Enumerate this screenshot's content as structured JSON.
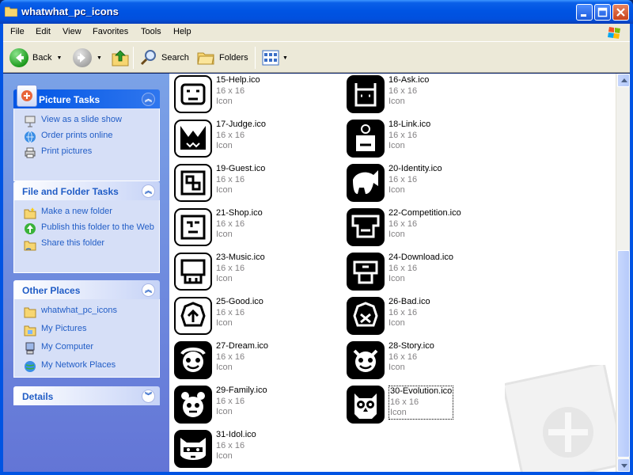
{
  "window": {
    "title": "whatwhat_pc_icons"
  },
  "menu": [
    "File",
    "Edit",
    "View",
    "Favorites",
    "Tools",
    "Help"
  ],
  "toolbar": {
    "back": "Back",
    "search": "Search",
    "folders": "Folders"
  },
  "panels": {
    "picture_tasks": {
      "title": "Picture Tasks",
      "items": [
        "View as a slide show",
        "Order prints online",
        "Print pictures"
      ]
    },
    "file_tasks": {
      "title": "File and Folder Tasks",
      "items": [
        "Make a new folder",
        "Publish this folder to the Web",
        "Share this folder"
      ]
    },
    "other_places": {
      "title": "Other Places",
      "items": [
        "whatwhat_pc_icons",
        "My Pictures",
        "My Computer",
        "My Network Places"
      ]
    },
    "details": {
      "title": "Details"
    }
  },
  "files": [
    {
      "name": "15-Help.ico",
      "dims": "16 x 16",
      "type": "Icon",
      "icon": "help-face-icon"
    },
    {
      "name": "16-Ask.ico",
      "dims": "16 x 16",
      "type": "Icon",
      "icon": "ask-face-icon"
    },
    {
      "name": "17-Judge.ico",
      "dims": "16 x 16",
      "type": "Icon",
      "icon": "judge-face-icon"
    },
    {
      "name": "18-Link.ico",
      "dims": "16 x 16",
      "type": "Icon",
      "icon": "link-robot-icon"
    },
    {
      "name": "19-Guest.ico",
      "dims": "16 x 16",
      "type": "Icon",
      "icon": "guest-maze-icon"
    },
    {
      "name": "20-Identity.ico",
      "dims": "16 x 16",
      "type": "Icon",
      "icon": "identity-elephant-icon"
    },
    {
      "name": "21-Shop.ico",
      "dims": "16 x 16",
      "type": "Icon",
      "icon": "shop-face-icon"
    },
    {
      "name": "22-Competition.ico",
      "dims": "16 x 16",
      "type": "Icon",
      "icon": "competition-face-icon"
    },
    {
      "name": "23-Music.ico",
      "dims": "16 x 16",
      "type": "Icon",
      "icon": "music-face-icon"
    },
    {
      "name": "24-Download.ico",
      "dims": "16 x 16",
      "type": "Icon",
      "icon": "download-face-icon"
    },
    {
      "name": "25-Good.ico",
      "dims": "16 x 16",
      "type": "Icon",
      "icon": "good-face-icon"
    },
    {
      "name": "26-Bad.ico",
      "dims": "16 x 16",
      "type": "Icon",
      "icon": "bad-face-icon"
    },
    {
      "name": "27-Dream.ico",
      "dims": "16 x 16",
      "type": "Icon",
      "icon": "dream-face-icon"
    },
    {
      "name": "28-Story.ico",
      "dims": "16 x 16",
      "type": "Icon",
      "icon": "story-face-icon"
    },
    {
      "name": "29-Family.ico",
      "dims": "16 x 16",
      "type": "Icon",
      "icon": "family-bear-icon"
    },
    {
      "name": "30-Evolution.ico",
      "dims": "16 x 16",
      "type": "Icon",
      "icon": "evolution-owl-icon"
    },
    {
      "name": "31-Idol.ico",
      "dims": "16 x 16",
      "type": "Icon",
      "icon": "idol-raccoon-icon"
    }
  ]
}
